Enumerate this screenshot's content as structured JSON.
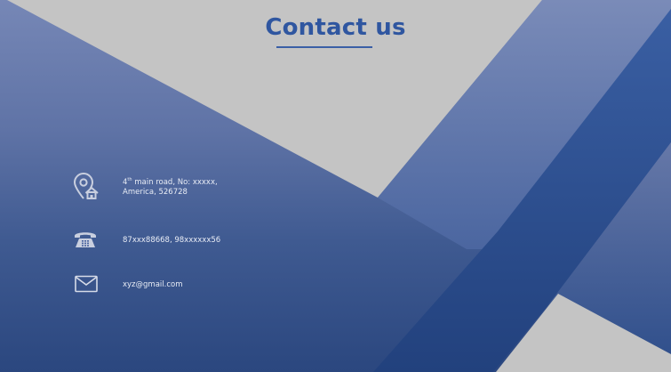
{
  "title": "Contact us",
  "contacts": {
    "address": {
      "icon": "location-home-icon",
      "ordinal_num": "4",
      "ordinal_suffix": "th",
      "line1_rest": " main road, No: xxxxx,",
      "line2": "America, 526728"
    },
    "phone": {
      "icon": "telephone-icon",
      "text": "87xxx88668, 98xxxxxx56"
    },
    "email": {
      "icon": "envelope-icon",
      "text": "xyz@gmail.com"
    }
  },
  "colors": {
    "title": "#2f56a0",
    "light_panel": "#c4c4c4",
    "dark_band": "#2a4a8a",
    "text": "#e8ecf5"
  }
}
